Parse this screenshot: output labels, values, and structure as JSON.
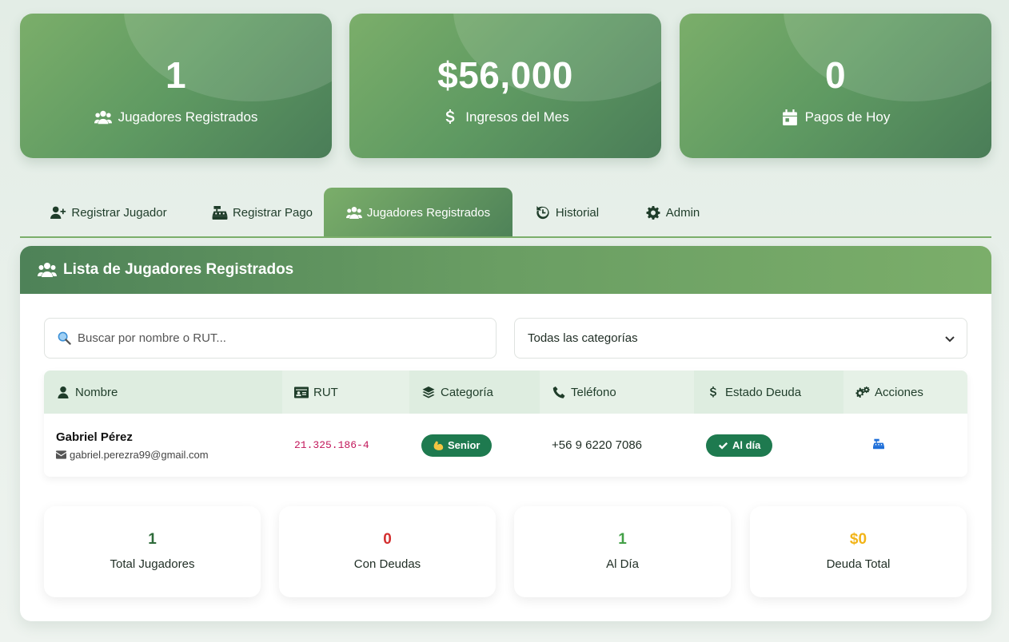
{
  "stats": [
    {
      "value": "1",
      "label": "Jugadores Registrados",
      "icon": "users-icon"
    },
    {
      "value": "$56,000",
      "label": "Ingresos del Mes",
      "icon": "dollar-icon"
    },
    {
      "value": "0",
      "label": "Pagos de Hoy",
      "icon": "calendar-icon"
    }
  ],
  "tabs": [
    {
      "label": "Registrar Jugador",
      "icon": "user-plus-icon",
      "active": false
    },
    {
      "label": "Registrar Pago",
      "icon": "cash-register-icon",
      "active": false
    },
    {
      "label": "Jugadores Registrados",
      "icon": "users-icon",
      "active": true
    },
    {
      "label": "Historial",
      "icon": "history-icon",
      "active": false
    },
    {
      "label": "Admin",
      "icon": "gear-icon",
      "active": false
    }
  ],
  "panel": {
    "title": "Lista de Jugadores Registrados",
    "search_placeholder": "Buscar por nombre o RUT...",
    "category_selected": "Todas las categorías"
  },
  "table": {
    "headers": [
      "Nombre",
      "RUT",
      "Categoría",
      "Teléfono",
      "Estado Deuda",
      "Acciones"
    ],
    "rows": [
      {
        "name": "Gabriel Pérez",
        "email": "gabriel.perezra99@gmail.com",
        "rut": "21.325.186-4",
        "category": "Senior",
        "phone": "+56 9 6220 7086",
        "debt_status": "Al día"
      }
    ]
  },
  "summary": [
    {
      "value": "1",
      "label": "Total Jugadores",
      "color": "#2e6b3a"
    },
    {
      "value": "0",
      "label": "Con Deudas",
      "color": "#d32f2f"
    },
    {
      "value": "1",
      "label": "Al Día",
      "color": "#43a047"
    },
    {
      "value": "$0",
      "label": "Deuda Total",
      "color": "#f2b418"
    }
  ],
  "colors": {
    "brand_green": "#5f9a62",
    "badge_green": "#1e7a4f",
    "action_blue": "#1e6fd9"
  }
}
